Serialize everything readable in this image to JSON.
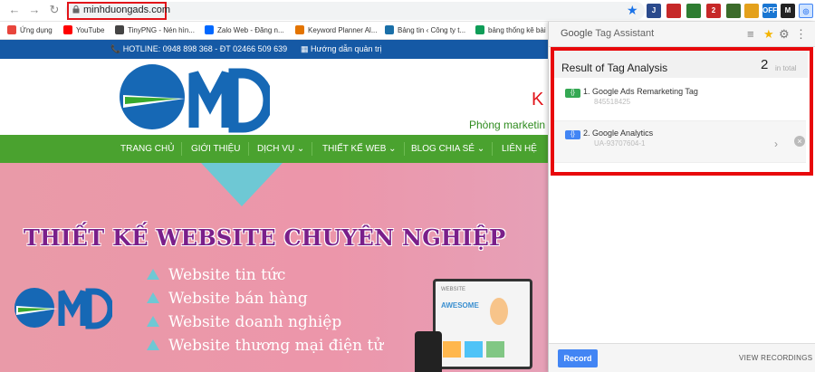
{
  "browser": {
    "url": "minhduongads.com",
    "bookmarks": [
      {
        "label": "Ứng dụng",
        "color": "#e8453c"
      },
      {
        "label": "YouTube",
        "color": "#ff0000"
      },
      {
        "label": "TinyPNG - Nén hìn...",
        "color": "#444444"
      },
      {
        "label": "Zalo Web - Đăng n...",
        "color": "#0068ff"
      },
      {
        "label": "Keyword Planner Al...",
        "color": "#e37400"
      },
      {
        "label": "Bảng tin ‹ Công ty t...",
        "color": "#1a6fa8"
      },
      {
        "label": "bảng thống kê bài",
        "color": "#0f9d58"
      }
    ],
    "extensions": [
      {
        "label": "J",
        "color": "#2b4a8c"
      },
      {
        "label": "",
        "color": "#c62828"
      },
      {
        "label": "",
        "color": "#2e7d32"
      },
      {
        "label": "2",
        "color": "#c62828"
      },
      {
        "label": "",
        "color": "#3b6b2a"
      },
      {
        "label": "",
        "color": "#e4a11b"
      },
      {
        "label": "OFF",
        "color": "#1976d2"
      },
      {
        "label": "M",
        "color": "#222222"
      }
    ]
  },
  "site": {
    "hotline": "HOTLINE: 0948 898 368 - ĐT 02466 509 639",
    "admin": "Hướng dẫn quản trị",
    "slogan_k": "K",
    "slogan": "Phòng marketin",
    "menu": [
      "TRANG CHỦ",
      "GIỚI THIỆU",
      "DỊCH VỤ",
      "THIẾT KẾ WEB",
      "BLOG CHIA SẺ",
      "LIÊN HỆ"
    ],
    "banner_title": "THIẾT KẾ WEBSITE CHUYÊN NGHIỆP",
    "features": [
      "Website tin tức",
      "Website bán hàng",
      "Website doanh nghiệp",
      "Website thương mại điện tử"
    ],
    "device_labels": {
      "small": "WEBSITE",
      "headline": "AWESOME"
    }
  },
  "panel": {
    "brand": "Google",
    "title": "Tag Assistant",
    "result_title": "Result of Tag Analysis",
    "count": "2",
    "count_suffix": "in total",
    "tags": [
      {
        "index": "1.",
        "name": "Google Ads Remarketing Tag",
        "id": "845518425",
        "badge_color": "#34a853",
        "badge": "{}"
      },
      {
        "index": "2.",
        "name": "Google Analytics",
        "id": "UA-93707604-1",
        "badge_color": "#4285f4",
        "badge": "{}"
      }
    ],
    "record": "Record",
    "view_recordings": "VIEW RECORDINGS"
  }
}
